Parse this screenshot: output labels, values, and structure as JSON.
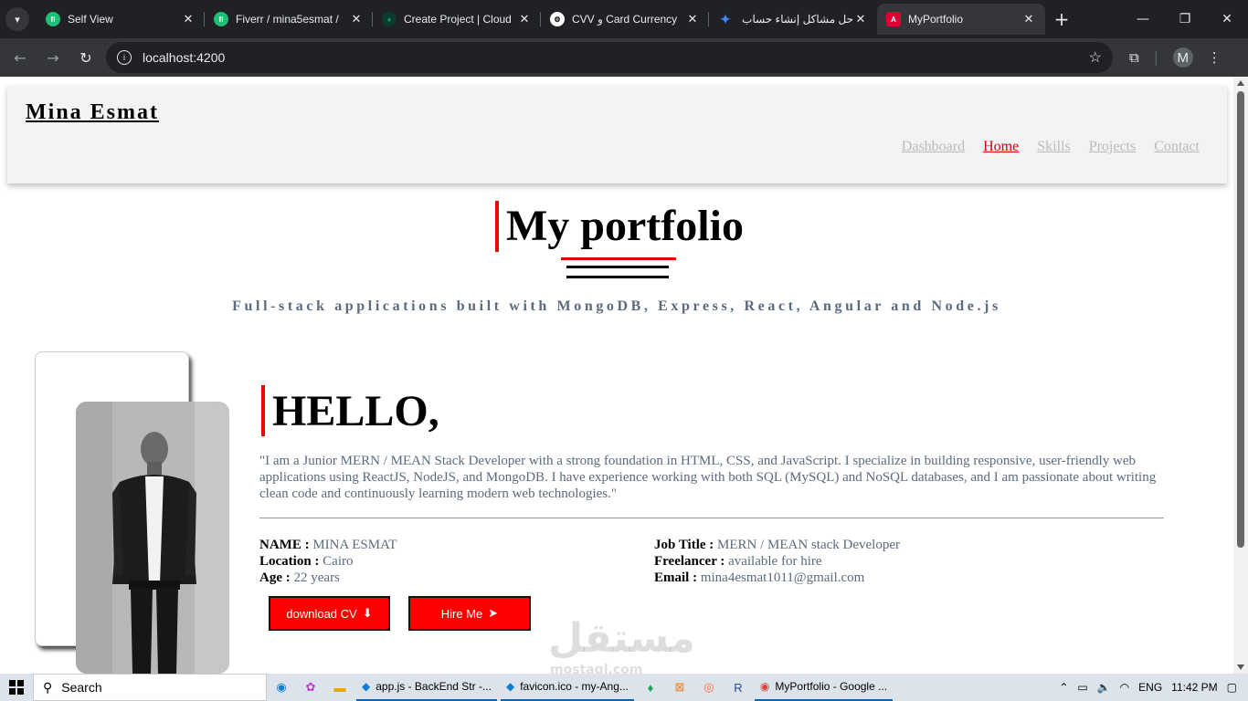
{
  "browser": {
    "tabs": [
      {
        "title": "Self View",
        "favicon_color": "#1dbf73",
        "favicon_text": "fi"
      },
      {
        "title": "Fiverr / mina5esmat /",
        "favicon_color": "#1dbf73",
        "favicon_text": "fi"
      },
      {
        "title": "Create Project | Cloud",
        "favicon_color": "#13aa52",
        "favicon_text": ""
      },
      {
        "title": "CVV و Card Currency",
        "favicon_color": "#555",
        "favicon_text": ""
      },
      {
        "title": "حل مشاكل إنشاء حساب",
        "favicon_color": "#4285f4",
        "favicon_text": ""
      },
      {
        "title": "MyPortfolio",
        "favicon_color": "#dd0031",
        "favicon_text": "A"
      }
    ],
    "url": "localhost:4200",
    "profile_initial": "M"
  },
  "site": {
    "brand": "Mina Esmat",
    "nav": [
      "Dashboard",
      "Home",
      "Skills",
      "Projects",
      "Contact"
    ],
    "title": "My portfolio",
    "tagline": "Full-stack applications built with MongoDB, Express, React, Angular and Node.js",
    "hello": "HELLO,",
    "intro": "\"I am a Junior MERN / MEAN Stack Developer with a strong foundation in HTML, CSS, and JavaScript. I specialize in building responsive, user-friendly web applications using ReactJS, NodeJS, and MongoDB. I have experience working with both SQL (MySQL) and NoSQL databases, and I am passionate about writing clean code and continuously learning modern web technologies.\"",
    "info_left": [
      {
        "k": "NAME :",
        "v": "MINA ESMAT"
      },
      {
        "k": "Location :",
        "v": "Cairo"
      },
      {
        "k": "Age :",
        "v": "22 years"
      }
    ],
    "info_right": [
      {
        "k": "Job Title :",
        "v": "MERN / MEAN stack Developer"
      },
      {
        "k": "Freelancer :",
        "v": "available for hire"
      },
      {
        "k": "Email :",
        "v": "mina4esmat1011@gmail.com"
      }
    ],
    "btn_cv": "download CV",
    "btn_hire": "Hire Me",
    "watermark": "مستقل",
    "watermark_sub": "mostaql.com"
  },
  "taskbar": {
    "search": "Search",
    "apps": [
      "app.js - BackEnd Str -...",
      "favicon.ico - my-Ang...",
      "MyPortfolio - Google ..."
    ],
    "lang": "ENG",
    "time": "11:42 PM"
  },
  "colors": {
    "accent": "#ff0000",
    "nav_active": "#dd0000",
    "muted_text": "#5b6a7d"
  }
}
